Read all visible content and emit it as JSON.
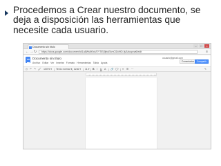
{
  "slide": {
    "bullet_text": "Procedemos a Crear nuestro documento, se deja a disposición las herramientas que necesite cada usuario."
  },
  "browser": {
    "tab_title": "Documento sin título",
    "window_buttons": [
      "–",
      "□",
      "×"
    ],
    "nav_glyphs": [
      "←",
      "→",
      "↻"
    ],
    "url": "https://docs.google.com/document/d/1a8WsN0wVEYTlEj9jhuEkmClDdHD-fjv3zkopvw6/edit",
    "menu_glyph": "≡"
  },
  "docs": {
    "title": "Documento sin título",
    "menu": [
      "Archivo",
      "Editar",
      "Ver",
      "Insertar",
      "Formato",
      "Herramientas",
      "Tabla",
      "Ayuda"
    ],
    "user": "usuario@gmail.com",
    "comments_label": "Comentarios",
    "share_label": "Compartir"
  },
  "toolbar": {
    "print": "⎙",
    "undo": "↶",
    "redo": "↷",
    "paint": "🖌",
    "zoom": "100% ▾",
    "style": "Texto normal ▾",
    "font": "Arial ▾",
    "size": "11 ▾",
    "bold": "B",
    "italic": "I",
    "underline": "U",
    "text_color": "A",
    "link": "🔗",
    "comment": "💬",
    "align": "≡",
    "list": "☰",
    "more": "⋯",
    "edit": "✎"
  },
  "colors": {
    "bullet": "#17375e",
    "docs_blue": "#4285f4",
    "share_blue": "#4d90fe"
  }
}
